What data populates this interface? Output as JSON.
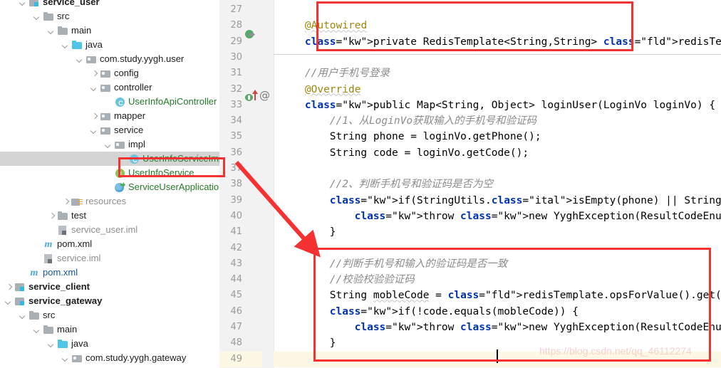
{
  "project_tree": {
    "items": [
      {
        "label": "service_user",
        "indent": 1,
        "twisty": "open",
        "icon": "module-folder-icon",
        "style": "bold"
      },
      {
        "label": "src",
        "indent": 2,
        "twisty": "open",
        "icon": "folder-icon",
        "style": ""
      },
      {
        "label": "main",
        "indent": 3,
        "twisty": "open",
        "icon": "folder-icon",
        "style": ""
      },
      {
        "label": "java",
        "indent": 4,
        "twisty": "open",
        "icon": "source-folder-icon",
        "style": ""
      },
      {
        "label": "com.study.yygh.user",
        "indent": 5,
        "twisty": "open",
        "icon": "package-icon",
        "style": ""
      },
      {
        "label": "config",
        "indent": 6,
        "twisty": "closed",
        "icon": "package-icon",
        "style": ""
      },
      {
        "label": "controller",
        "indent": 6,
        "twisty": "open",
        "icon": "package-icon",
        "style": ""
      },
      {
        "label": "UserInfoApiController",
        "indent": 7,
        "twisty": "none",
        "icon": "java-class-icon",
        "style": "green"
      },
      {
        "label": "mapper",
        "indent": 6,
        "twisty": "closed",
        "icon": "package-icon",
        "style": ""
      },
      {
        "label": "service",
        "indent": 6,
        "twisty": "open",
        "icon": "package-icon",
        "style": ""
      },
      {
        "label": "impl",
        "indent": 7,
        "twisty": "open",
        "icon": "package-icon",
        "style": ""
      },
      {
        "label": "UserInfoServiceImpl",
        "indent": 8,
        "twisty": "none",
        "icon": "java-class-icon",
        "style": "green",
        "selected": true
      },
      {
        "label": "UserInfoService",
        "indent": 7,
        "twisty": "none",
        "icon": "java-interface-icon",
        "style": "green"
      },
      {
        "label": "ServiceUserApplication",
        "indent": 7,
        "twisty": "none",
        "icon": "spring-boot-icon",
        "style": "green"
      },
      {
        "label": "resources",
        "indent": 4,
        "twisty": "closed",
        "icon": "resources-folder-icon",
        "style": "grey"
      },
      {
        "label": "test",
        "indent": 3,
        "twisty": "closed",
        "icon": "folder-icon",
        "style": ""
      },
      {
        "label": "service_user.iml",
        "indent": 3,
        "twisty": "none",
        "icon": "iml-file-icon",
        "style": "grey"
      },
      {
        "label": "pom.xml",
        "indent": 2,
        "twisty": "none",
        "icon": "maven-pom-icon",
        "style": ""
      },
      {
        "label": "service.iml",
        "indent": 2,
        "twisty": "none",
        "icon": "iml-file-icon",
        "style": "grey"
      },
      {
        "label": "pom.xml",
        "indent": 1,
        "twisty": "none",
        "icon": "maven-pom-icon",
        "style": "blue"
      },
      {
        "label": "service_client",
        "indent": 0,
        "twisty": "closed",
        "icon": "module-folder-icon",
        "style": "bold"
      },
      {
        "label": "service_gateway",
        "indent": 0,
        "twisty": "open",
        "icon": "module-folder-icon",
        "style": "bold"
      },
      {
        "label": "src",
        "indent": 1,
        "twisty": "open",
        "icon": "folder-icon",
        "style": ""
      },
      {
        "label": "main",
        "indent": 2,
        "twisty": "open",
        "icon": "folder-icon",
        "style": ""
      },
      {
        "label": "java",
        "indent": 3,
        "twisty": "open",
        "icon": "source-folder-icon",
        "style": ""
      },
      {
        "label": "com.study.yygh.gateway",
        "indent": 4,
        "twisty": "open",
        "icon": "package-icon",
        "style": ""
      }
    ]
  },
  "editor": {
    "first_line_number": 27,
    "line_numbers": [
      27,
      28,
      29,
      30,
      31,
      32,
      33,
      34,
      35,
      36,
      37,
      38,
      39,
      40,
      41,
      42,
      43,
      44,
      45,
      46,
      47,
      48,
      49
    ],
    "current_line": 49,
    "gutter_icons": [
      "override-method-icon",
      "spring-bean-icon",
      "implemented-method-icon",
      "annotation-at-icon"
    ],
    "lines": [
      {
        "n": 27,
        "text": ""
      },
      {
        "n": 28,
        "text": "    @Autowired"
      },
      {
        "n": 29,
        "text": "    private RedisTemplate<String,String> redisTemplate;"
      },
      {
        "n": 30,
        "text": ""
      },
      {
        "n": 31,
        "text": "    //用户手机号登录"
      },
      {
        "n": 32,
        "text": "    @Override"
      },
      {
        "n": 33,
        "text": "    public Map<String, Object> loginUser(LoginVo loginVo) {"
      },
      {
        "n": 34,
        "text": "        //1、从LoginVo获取输入的手机号和验证码"
      },
      {
        "n": 35,
        "text": "        String phone = loginVo.getPhone();"
      },
      {
        "n": 36,
        "text": "        String code = loginVo.getCode();"
      },
      {
        "n": 37,
        "text": ""
      },
      {
        "n": 38,
        "text": "        //2、判断手机号和验证码是否为空"
      },
      {
        "n": 39,
        "text": "        if(StringUtils.isEmpty(phone) || StringUtils.isEmpty(code)){"
      },
      {
        "n": 40,
        "text": "            throw new YyghException(ResultCodeEnum.PARAM_ERROR);"
      },
      {
        "n": 41,
        "text": "        }"
      },
      {
        "n": 42,
        "text": ""
      },
      {
        "n": 43,
        "text": "        //判断手机号和输入的验证码是否一致"
      },
      {
        "n": 44,
        "text": "        //校验校验验证码"
      },
      {
        "n": 45,
        "text": "        String mobleCode = redisTemplate.opsForValue().get(phone);"
      },
      {
        "n": 46,
        "text": "        if(!code.equals(mobleCode)) {"
      },
      {
        "n": 47,
        "text": "            throw new YyghException(ResultCodeEnum.CODE_ERROR);"
      },
      {
        "n": 48,
        "text": "        }"
      },
      {
        "n": 49,
        "text": ""
      }
    ]
  },
  "annotations": {
    "highlight_color": "#f53131",
    "boxes": [
      {
        "name": "redis-template-field-box"
      },
      {
        "name": "verify-code-check-box"
      },
      {
        "name": "selected-file-box"
      }
    ],
    "arrow": {
      "name": "pointer-arrow",
      "from": "selected-file-box",
      "to": "verify-code-check-box"
    }
  },
  "watermark": {
    "text": "https://blog.csdn.net/qq_46112274"
  }
}
